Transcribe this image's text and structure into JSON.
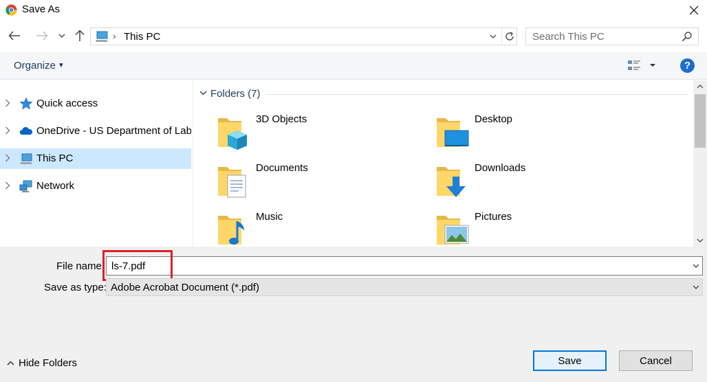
{
  "window": {
    "title": "Save As",
    "app_icon": "chrome-icon"
  },
  "navigation": {
    "back_icon": "arrow-left-icon",
    "forward_icon": "arrow-right-icon",
    "recent_icon": "chevron-down-icon",
    "up_icon": "arrow-up-icon",
    "address_path": "This PC",
    "search_placeholder": "Search This PC"
  },
  "toolbar": {
    "organize_label": "Organize",
    "help_label": "?"
  },
  "nav_pane": {
    "items": [
      {
        "label": "Quick access",
        "icon": "star-icon",
        "selected": false
      },
      {
        "label": "OneDrive - US Department of Lab",
        "icon": "cloud-icon",
        "selected": false
      },
      {
        "label": "This PC",
        "icon": "computer-icon",
        "selected": true
      },
      {
        "label": "Network",
        "icon": "network-icon",
        "selected": false
      }
    ]
  },
  "content": {
    "group_header": "Folders (7)",
    "folders": [
      {
        "label": "3D Objects",
        "icon": "3d-objects-folder-icon"
      },
      {
        "label": "Desktop",
        "icon": "desktop-folder-icon"
      },
      {
        "label": "Documents",
        "icon": "documents-folder-icon"
      },
      {
        "label": "Downloads",
        "icon": "downloads-folder-icon"
      },
      {
        "label": "Music",
        "icon": "music-folder-icon"
      },
      {
        "label": "Pictures",
        "icon": "pictures-folder-icon"
      }
    ]
  },
  "form": {
    "file_name_label": "File name:",
    "file_name_value": "ls-7.pdf",
    "save_type_label": "Save as type:",
    "save_type_value": "Adobe Acrobat Document (*.pdf)"
  },
  "footer": {
    "hide_folders_label": "Hide Folders",
    "save_label": "Save",
    "cancel_label": "Cancel"
  },
  "colors": {
    "accent": "#0078d7",
    "selection": "#cce8ff",
    "highlight_box": "#dd1f2a",
    "link_text": "#1e395b"
  }
}
